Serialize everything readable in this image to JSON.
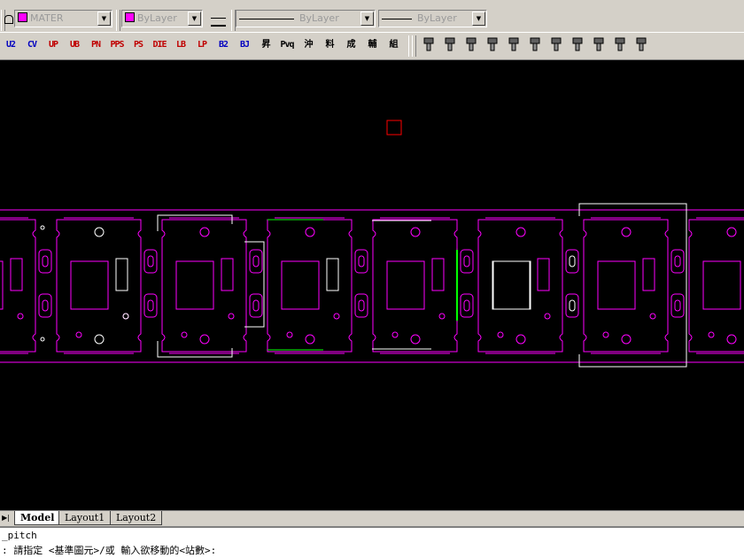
{
  "layer_toolbar": {
    "layer_combo": "MATER",
    "color_combo": "ByLayer",
    "linetype_combo": "ByLayer",
    "lineweight_combo": "ByLayer"
  },
  "custom_toolbar": {
    "buttons": [
      {
        "label": "U2",
        "color": "#0000c0"
      },
      {
        "label": "CV",
        "color": "#0000c0"
      },
      {
        "label": "UP",
        "color": "#c00000"
      },
      {
        "label": "UB",
        "color": "#c00000"
      },
      {
        "label": "PN",
        "color": "#c00000"
      },
      {
        "label": "PPS",
        "color": "#c00000"
      },
      {
        "label": "PS",
        "color": "#c00000"
      },
      {
        "label": "DIE",
        "color": "#c00000"
      },
      {
        "label": "LB",
        "color": "#c00000"
      },
      {
        "label": "LP",
        "color": "#c00000"
      },
      {
        "label": "B2",
        "color": "#0000c0"
      },
      {
        "label": "BJ",
        "color": "#0000c0"
      },
      {
        "label": "昇",
        "color": "#000000"
      },
      {
        "label": "Pvq",
        "color": "#000000"
      },
      {
        "label": "沖",
        "color": "#000000"
      },
      {
        "label": "料",
        "color": "#000000"
      },
      {
        "label": "成",
        "color": "#000000"
      },
      {
        "label": "輔",
        "color": "#000000"
      },
      {
        "label": "組",
        "color": "#000000"
      }
    ],
    "tool_icons": [
      "punch-icon",
      "punch-icon",
      "punch-pins-icon",
      "stripper-icon",
      "lp-icon",
      "layers-icon",
      "part-icon",
      "plate-icon",
      "frame-icon",
      "tool-icon",
      "auxiliary-icon"
    ]
  },
  "layout_tabs": {
    "tabs": [
      "Model",
      "Layout1",
      "Layout2"
    ],
    "active": "Model"
  },
  "command": {
    "history": "_pitch",
    "prompt": ": 請指定 <基準圖元>/或 輸入欲移動的<站數>:"
  },
  "colors": {
    "outline": "#ff00ff",
    "highlight": "#ffffff",
    "accent": "#00ff00",
    "marker": "#ff0000",
    "background": "#000000"
  }
}
